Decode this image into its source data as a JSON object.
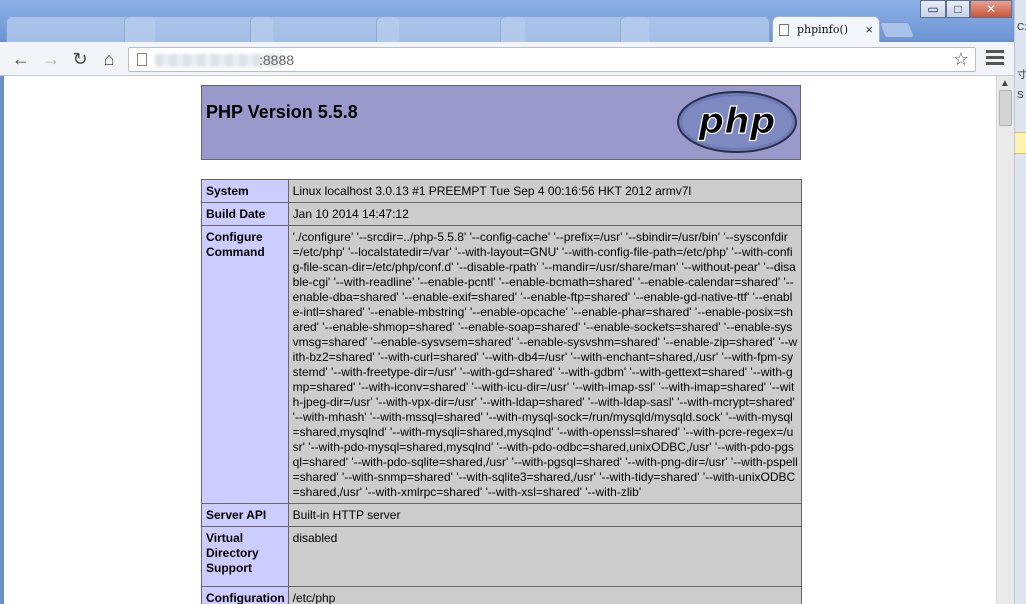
{
  "browser": {
    "active_tab_title": "phpinfo()",
    "tab_close_glyph": "×",
    "window_controls": {
      "minimize": "▭",
      "maximize": "□",
      "close": "✕"
    },
    "address_port": ":8888",
    "icons": [
      "back-arrow-icon",
      "forward-arrow-icon",
      "reload-icon",
      "home-icon",
      "page-icon",
      "star-icon",
      "menu-icon"
    ]
  },
  "page": {
    "title": "PHP Version 5.5.8",
    "logo_text": "php",
    "rows": [
      {
        "key": "System",
        "value": "Linux localhost 3.0.13 #1 PREEMPT Tue Sep 4 00:16:56 HKT 2012 armv7l"
      },
      {
        "key": "Build Date",
        "value": "Jan 10 2014 14:47:12"
      },
      {
        "key": "Configure Command",
        "value": "'./configure' '--srcdir=../php-5.5.8' '--config-cache' '--prefix=/usr' '--sbindir=/usr/bin' '--sysconfdir=/etc/php' '--localstatedir=/var' '--with-layout=GNU' '--with-config-file-path=/etc/php' '--with-config-file-scan-dir=/etc/php/conf.d' '--disable-rpath' '--mandir=/usr/share/man' '--without-pear' '--disable-cgi' '--with-readline' '--enable-pcntl' '--enable-bcmath=shared' '--enable-calendar=shared' '--enable-dba=shared' '--enable-exif=shared' '--enable-ftp=shared' '--enable-gd-native-ttf' '--enable-intl=shared' '--enable-mbstring' '--enable-opcache' '--enable-phar=shared' '--enable-posix=shared' '--enable-shmop=shared' '--enable-soap=shared' '--enable-sockets=shared' '--enable-sysvmsg=shared' '--enable-sysvsem=shared' '--enable-sysvshm=shared' '--enable-zip=shared' '--with-bz2=shared' '--with-curl=shared' '--with-db4=/usr' '--with-enchant=shared,/usr' '--with-fpm-systemd' '--with-freetype-dir=/usr' '--with-gd=shared' '--with-gdbm' '--with-gettext=shared' '--with-gmp=shared' '--with-iconv=shared' '--with-icu-dir=/usr' '--with-imap-ssl' '--with-imap=shared' '--with-jpeg-dir=/usr' '--with-vpx-dir=/usr' '--with-ldap=shared' '--with-ldap-sasl' '--with-mcrypt=shared' '--with-mhash' '--with-mssql=shared' '--with-mysql-sock=/run/mysqld/mysqld.sock' '--with-mysql=shared,mysqlnd' '--with-mysqli=shared,mysqlnd' '--with-openssl=shared' '--with-pcre-regex=/usr' '--with-pdo-mysql=shared,mysqlnd' '--with-pdo-odbc=shared,unixODBC,/usr' '--with-pdo-pgsql=shared' '--with-pdo-sqlite=shared,/usr' '--with-pgsql=shared' '--with-png-dir=/usr' '--with-pspell=shared' '--with-snmp=shared' '--with-sqlite3=shared,/usr' '--with-tidy=shared' '--with-unixODBC=shared,/usr' '--with-xmlrpc=shared' '--with-xsl=shared' '--with-zlib'"
      },
      {
        "key": "Server API",
        "value": "Built-in HTTP server"
      },
      {
        "key": "Virtual Directory Support",
        "value": "disabled"
      },
      {
        "key": "Configuration",
        "value": "/etc/php"
      }
    ]
  },
  "right_strip": {
    "s1": "C:",
    "s2": "寸",
    "s3": "S"
  },
  "colors": {
    "header_bg": "#9999cc",
    "key_bg": "#ccccff",
    "value_bg": "#cccccc"
  }
}
